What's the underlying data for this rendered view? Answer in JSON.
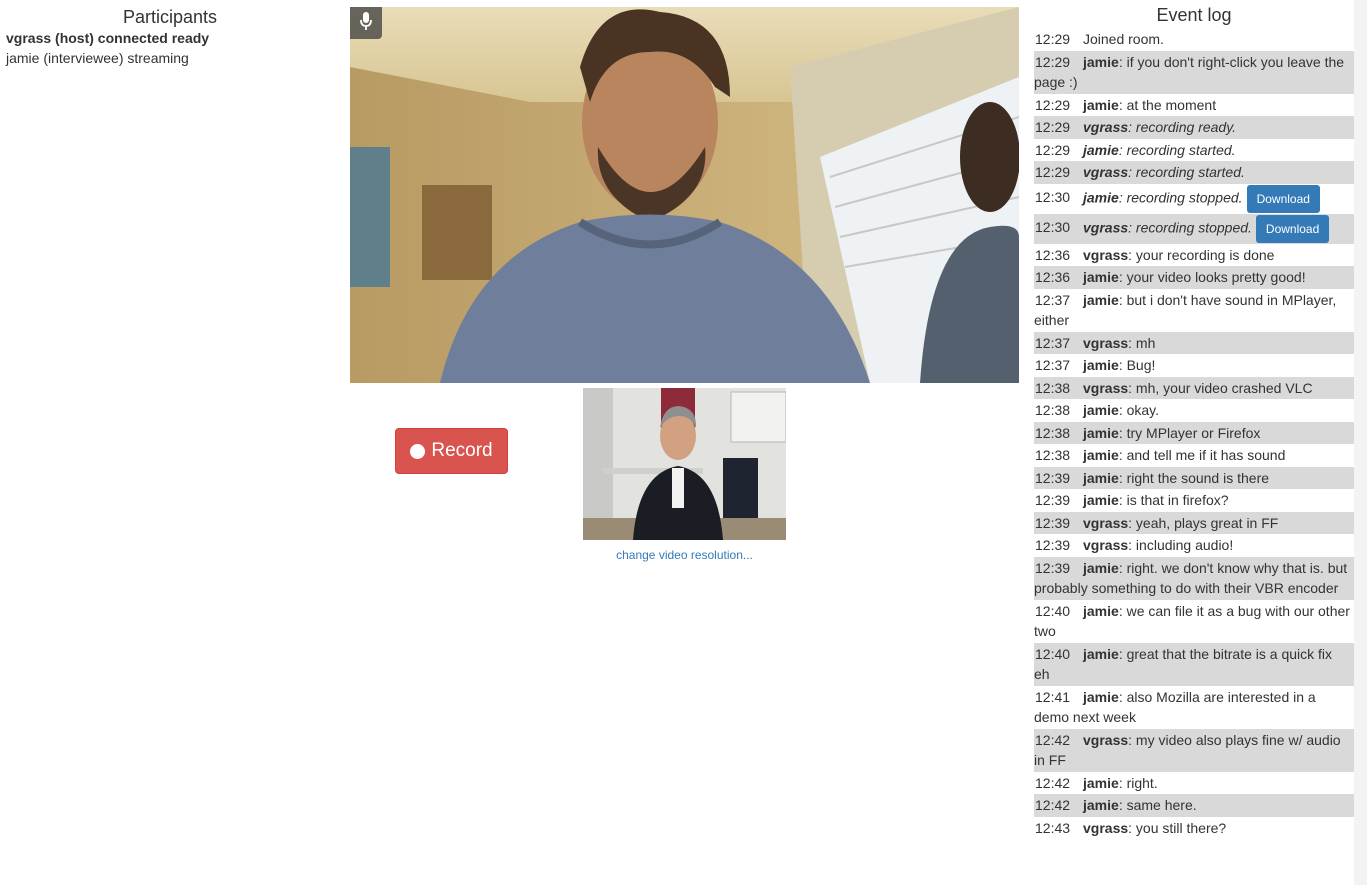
{
  "participants": {
    "title": "Participants",
    "list": [
      {
        "text": "vgrass (host) connected ready",
        "bold": true
      },
      {
        "text": "jamie (interviewee) streaming",
        "bold": false
      }
    ]
  },
  "controls": {
    "record_label": "Record",
    "change_resolution": "change video resolution..."
  },
  "event_log": {
    "title": "Event log",
    "download_label": "Download",
    "rows": [
      {
        "time": "12:29",
        "user": "",
        "msg": "Joined room.",
        "italic": false,
        "download": false
      },
      {
        "time": "12:29",
        "user": "jamie",
        "msg": ": if you don't right-click you leave the page :)",
        "italic": false,
        "download": false
      },
      {
        "time": "12:29",
        "user": "jamie",
        "msg": ": at the moment",
        "italic": false,
        "download": false
      },
      {
        "time": "12:29",
        "user": "vgrass",
        "msg": ": recording ready.",
        "italic": true,
        "download": false
      },
      {
        "time": "12:29",
        "user": "jamie",
        "msg": ": recording started.",
        "italic": true,
        "download": false
      },
      {
        "time": "12:29",
        "user": "vgrass",
        "msg": ": recording started.",
        "italic": true,
        "download": false
      },
      {
        "time": "12:30",
        "user": "jamie",
        "msg": ": recording stopped.",
        "italic": true,
        "download": true
      },
      {
        "time": "12:30",
        "user": "vgrass",
        "msg": ": recording stopped.",
        "italic": true,
        "download": true
      },
      {
        "time": "12:36",
        "user": "vgrass",
        "msg": ": your recording is done",
        "italic": false,
        "download": false
      },
      {
        "time": "12:36",
        "user": "jamie",
        "msg": ": your video looks pretty good!",
        "italic": false,
        "download": false
      },
      {
        "time": "12:37",
        "user": "jamie",
        "msg": ": but i don't have sound in MPlayer, either",
        "italic": false,
        "download": false
      },
      {
        "time": "12:37",
        "user": "vgrass",
        "msg": ": mh",
        "italic": false,
        "download": false
      },
      {
        "time": "12:37",
        "user": "jamie",
        "msg": ": Bug!",
        "italic": false,
        "download": false
      },
      {
        "time": "12:38",
        "user": "vgrass",
        "msg": ": mh, your video crashed VLC",
        "italic": false,
        "download": false
      },
      {
        "time": "12:38",
        "user": "jamie",
        "msg": ": okay.",
        "italic": false,
        "download": false
      },
      {
        "time": "12:38",
        "user": "jamie",
        "msg": ": try MPlayer or Firefox",
        "italic": false,
        "download": false
      },
      {
        "time": "12:38",
        "user": "jamie",
        "msg": ": and tell me if it has sound",
        "italic": false,
        "download": false
      },
      {
        "time": "12:39",
        "user": "jamie",
        "msg": ": right the sound is there",
        "italic": false,
        "download": false
      },
      {
        "time": "12:39",
        "user": "jamie",
        "msg": ": is that in firefox?",
        "italic": false,
        "download": false
      },
      {
        "time": "12:39",
        "user": "vgrass",
        "msg": ": yeah, plays great in FF",
        "italic": false,
        "download": false
      },
      {
        "time": "12:39",
        "user": "vgrass",
        "msg": ": including audio!",
        "italic": false,
        "download": false
      },
      {
        "time": "12:39",
        "user": "jamie",
        "msg": ": right. we don't know why that is. but probably something to do with their VBR encoder",
        "italic": false,
        "download": false
      },
      {
        "time": "12:40",
        "user": "jamie",
        "msg": ": we can file it as a bug with our other two",
        "italic": false,
        "download": false
      },
      {
        "time": "12:40",
        "user": "jamie",
        "msg": ": great that the bitrate is a quick fix eh",
        "italic": false,
        "download": false
      },
      {
        "time": "12:41",
        "user": "jamie",
        "msg": ": also Mozilla are interested in a demo next week",
        "italic": false,
        "download": false
      },
      {
        "time": "12:42",
        "user": "vgrass",
        "msg": ": my video also plays fine w/ audio in FF",
        "italic": false,
        "download": false
      },
      {
        "time": "12:42",
        "user": "jamie",
        "msg": ": right.",
        "italic": false,
        "download": false
      },
      {
        "time": "12:42",
        "user": "jamie",
        "msg": ": same here.",
        "italic": false,
        "download": false
      },
      {
        "time": "12:43",
        "user": "vgrass",
        "msg": ": you still there?",
        "italic": false,
        "download": false
      }
    ]
  }
}
